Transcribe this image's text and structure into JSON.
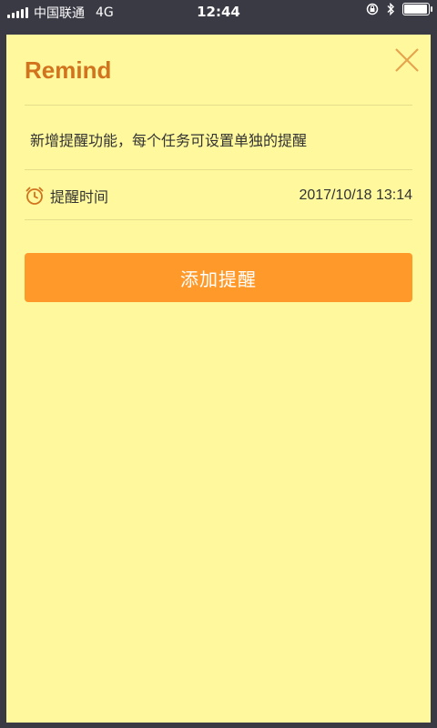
{
  "status_bar": {
    "carrier": "中国联通",
    "network": "4G",
    "time": "12:44",
    "battery_level": 0.95
  },
  "card": {
    "title": "Remind",
    "description": "新增提醒功能，每个任务可设置单独的提醒",
    "remind_label": "提醒时间",
    "remind_time": "2017/10/18 13:14",
    "add_button_label": "添加提醒"
  },
  "colors": {
    "card_background": "#fff89d",
    "accent": "#d2731e",
    "button": "#ff992a",
    "status_bar": "#3a3a45"
  },
  "icons": {
    "close": "close-icon",
    "alarm": "alarm-clock-icon",
    "bluetooth": "bluetooth-icon",
    "rotation_lock": "rotation-lock-icon",
    "battery": "battery-icon",
    "signal": "signal-bars-icon"
  }
}
